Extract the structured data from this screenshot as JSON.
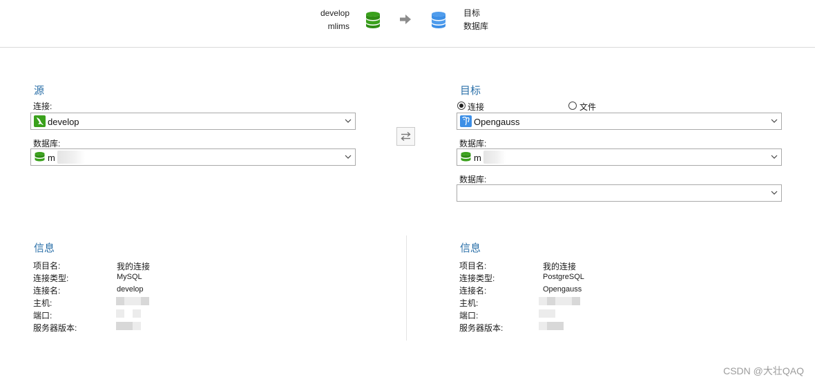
{
  "header": {
    "source_connection": "develop",
    "source_database": "mlims",
    "target_label": "目标",
    "target_database_label": "数据库"
  },
  "source": {
    "title": "源",
    "connection_label": "连接:",
    "connection_value": "develop",
    "database_label": "数据库:",
    "database_value": "m"
  },
  "target": {
    "title": "目标",
    "radio_connection": "连接",
    "radio_file": "文件",
    "connection_value": "Opengauss",
    "database_label": "数据库:",
    "database_value": "m",
    "schema_label": "数据库:",
    "schema_value": ""
  },
  "source_info": {
    "title": "信息",
    "keys": [
      "项目名:",
      "连接类型:",
      "连接名:",
      "主机:",
      "端口:",
      "服务器版本:"
    ],
    "values": [
      "我的连接",
      "MySQL",
      "develop"
    ]
  },
  "target_info": {
    "title": "信息",
    "keys": [
      "项目名:",
      "连接类型:",
      "连接名:",
      "主机:",
      "端口:",
      "服务器版本:"
    ],
    "values": [
      "我的连接",
      "PostgreSQL",
      "Opengauss"
    ]
  },
  "watermark": "CSDN @大壮QAQ",
  "colors": {
    "accent": "#2a6fa8",
    "mysql_green": "#3aa11c",
    "pg_blue": "#3d8fe6"
  },
  "icons": {
    "source_db": "database-green-icon",
    "target_db": "database-blue-icon",
    "mysql": "mysql-dolphin-icon",
    "postgres": "postgres-elephant-icon"
  }
}
